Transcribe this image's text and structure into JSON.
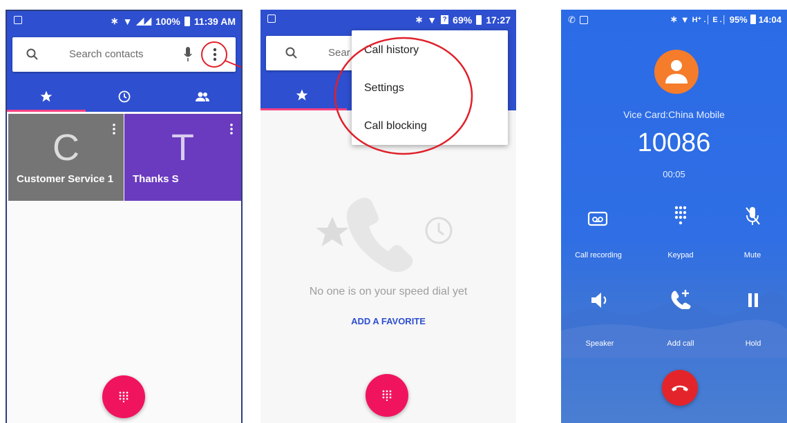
{
  "phone1": {
    "status": {
      "time": "11:39 AM",
      "battery": "100%"
    },
    "search_placeholder": "Search contacts",
    "tiles": [
      {
        "letter": "C",
        "name": "Customer Service 1",
        "color": "#757575"
      },
      {
        "letter": "T",
        "name": "Thanks S",
        "color": "#6a3bbf"
      }
    ],
    "tab_icons": [
      "star-icon",
      "clock-icon",
      "people-icon"
    ],
    "annotation": "callout-circle-red"
  },
  "phone2": {
    "status": {
      "time": "17:27",
      "battery": "69%"
    },
    "search_partial": "Sear",
    "menu": [
      "Call history",
      "Settings",
      "Call blocking"
    ],
    "empty_message": "No one is on your speed dial yet",
    "add_favorite": "ADD A FAVORITE"
  },
  "phone3": {
    "status": {
      "time": "14:04",
      "battery": "95%",
      "network": "H⁺ .│ E .│"
    },
    "carrier": "Vice Card:China Mobile",
    "number": "10086",
    "duration": "00:05",
    "controls": [
      "Call recording",
      "Keypad",
      "Mute",
      "Speaker",
      "Add call",
      "Hold"
    ]
  },
  "colors": {
    "primary": "#2e4fd0",
    "accent": "#f0145e",
    "call_blue": "#2b6be6",
    "end_call": "#e3252b",
    "avatar": "#f57c2a",
    "annotation": "#e0202a"
  }
}
